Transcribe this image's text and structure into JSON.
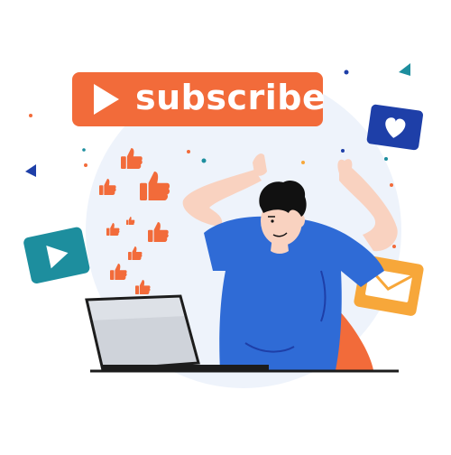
{
  "subscribe_button": {
    "label": "subscribe",
    "color": "#F26B3A"
  },
  "icons": {
    "play_card": "play-icon",
    "heart_card": "heart-icon",
    "mail_card": "mail-icon",
    "thumbs": "thumbs-up-icon"
  },
  "colors": {
    "accent_orange": "#F26B3A",
    "teal": "#1D8E9E",
    "navy": "#1E3FA8",
    "shirt_blue": "#2F6BD6",
    "envelope_orange": "#F7A73A",
    "laptop_gray": "#CFD3DA",
    "skin": "#F9D2C0",
    "hair": "#111111",
    "bg_circle": "#EEF3FB"
  }
}
